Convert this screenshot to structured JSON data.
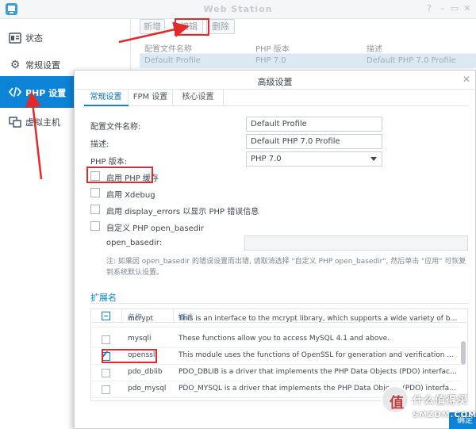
{
  "window": {
    "title": "Web Station",
    "controls": [
      "?",
      "–",
      "▭",
      "✕"
    ]
  },
  "sidebar": {
    "items": [
      {
        "label": "状态",
        "icon": "status-icon"
      },
      {
        "label": "常规设置",
        "icon": "gear-icon"
      },
      {
        "label": "PHP 设置",
        "icon": "code-icon",
        "selected": true
      },
      {
        "label": "虚拟主机",
        "icon": "virtual-host-icon"
      }
    ]
  },
  "toolbar": {
    "new_label": "新增",
    "edit_label": "编辑",
    "delete_label": "删除"
  },
  "profile_table": {
    "columns": [
      "配置文件名称",
      "PHP 版本",
      "描述"
    ],
    "rows": [
      [
        "Default Profile",
        "PHP 7.0",
        "Default PHP 7.0 Profile"
      ]
    ]
  },
  "dialog": {
    "title": "高级设置",
    "close_icon": "close-icon",
    "tabs": [
      "常规设置",
      "FPM 设置",
      "核心设置"
    ],
    "active_tab": "常规设置",
    "form": {
      "profile_label": "配置文件名称:",
      "profile_value": "Default Profile",
      "desc_label": "描述:",
      "desc_value": "Default PHP 7.0 Profile",
      "phpver_label": "PHP 版本:",
      "phpver_value": "PHP 7.0",
      "cache_label": "启用 PHP 缓存",
      "xdebug_label": "启用 Xdebug",
      "display_errors_label": "启用 display_errors 以显示 PHP 错误信息",
      "basedir_custom_label": "自定义 PHP open_basedir",
      "basedir_label": "open_basedir:",
      "note": "注: 如果因 open_basedir 的错误设置而出错, 请取消选择 \"自定义 PHP open_basedir\", 然后单击 \"应用\" 可恢复到系统默认设置。"
    },
    "extensions": {
      "section_title": "扩展名",
      "columns": {
        "name": "名称",
        "desc": "描述"
      },
      "rows": [
        {
          "name": "mcrypt",
          "desc": "This is an interface to the mcrypt library, which supports a wide variety of block al...",
          "checked": false
        },
        {
          "name": "mysqli",
          "desc": "These functions allow you to access MySQL 4.1 and above.",
          "checked": false
        },
        {
          "name": "openssl",
          "desc": "This module uses the functions of OpenSSL for generation and verification of signa...",
          "checked": true
        },
        {
          "name": "pdo_dblib",
          "desc": "PDO_DBLIB is a driver that implements the PHP Data Objects (PDO) interface to e...",
          "checked": false
        },
        {
          "name": "pdo_mysql",
          "desc": "PDO_MYSQL is a driver that implements the PHP Data Objects (PDO) interface to e...",
          "checked": false
        }
      ],
      "checkmark": "✔"
    },
    "footer_button": "确定"
  },
  "watermark": {
    "line1": "什么值得买",
    "line2": "SMZDM.COM",
    "logo_glyph": "值"
  },
  "colors": {
    "accent": "#0b83d6",
    "annotation": "#e32a2a"
  }
}
